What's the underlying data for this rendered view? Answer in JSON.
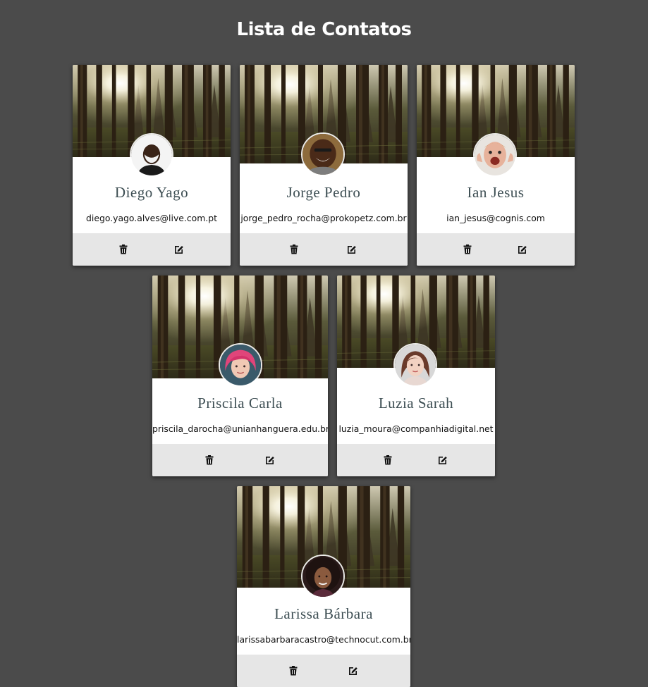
{
  "page": {
    "title": "Lista de Contatos"
  },
  "colors": {
    "background": "#4b4b4b",
    "card": "#ffffff",
    "actions_bar": "#e6e6e6",
    "name_text": "#3d4e53",
    "email_text": "#111111"
  },
  "contacts": [
    {
      "name": "Diego Yago",
      "email": "diego.yago.alves@live.com.pt",
      "delete_icon": "trash-icon",
      "edit_icon": "edit-icon"
    },
    {
      "name": "Jorge Pedro",
      "email": "jorge_pedro_rocha@prokopetz.com.br",
      "delete_icon": "trash-icon",
      "edit_icon": "edit-icon"
    },
    {
      "name": "Ian Jesus",
      "email": "ian_jesus@cognis.com",
      "delete_icon": "trash-icon",
      "edit_icon": "edit-icon"
    },
    {
      "name": "Priscila Carla",
      "email": "priscila_darocha@unianhanguera.edu.br",
      "delete_icon": "trash-icon",
      "edit_icon": "edit-icon"
    },
    {
      "name": "Luzia Sarah",
      "email": "luzia_moura@companhiadigital.net",
      "delete_icon": "trash-icon",
      "edit_icon": "edit-icon"
    },
    {
      "name": "Larissa Bárbara",
      "email": "larissabarbaracastro@technocut.com.br",
      "delete_icon": "trash-icon",
      "edit_icon": "edit-icon"
    }
  ]
}
